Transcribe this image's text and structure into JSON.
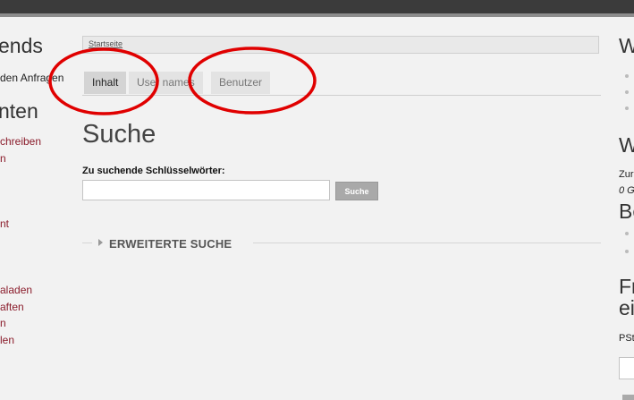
{
  "left_sidebar": {
    "heading_1": "ends",
    "link_1": "den Anfragen",
    "heading_2": "nten",
    "links": [
      "chreiben",
      "n",
      "nt",
      "aladen",
      "aften",
      "n",
      "len"
    ]
  },
  "breadcrumb": {
    "home": "Startseite"
  },
  "tabs": [
    {
      "label": "Inhalt",
      "active": true
    },
    {
      "label": "User names",
      "active": false
    },
    {
      "label": "Benutzer",
      "active": false
    }
  ],
  "page": {
    "title": "Suche"
  },
  "search": {
    "label": "Zu suchende Schlüsselwörter:",
    "value": "",
    "button_label": "Suche"
  },
  "advanced": {
    "label": "ERWEITERTE SUCHE",
    "icon": "triangle-right-icon"
  },
  "right_sidebar": {
    "heading_1": "W",
    "heading_2": "W",
    "text_1": "Zur",
    "text_2": "0 G",
    "heading_3": "Be",
    "heading_4a": "Fr",
    "heading_4b": "ei",
    "text_3": "PSt"
  },
  "colors": {
    "link": "#8a1c2b",
    "annotation": "#e00000",
    "topbar": "#3b3b3b"
  }
}
